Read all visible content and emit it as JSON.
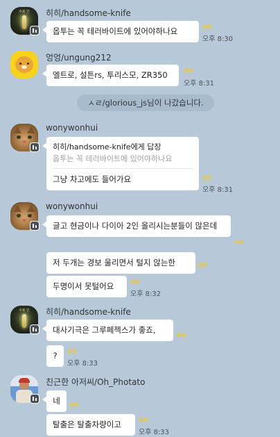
{
  "system": {
    "left_message": "ㅅㄹ/glorious_js님이 나갔습니다."
  },
  "users": {
    "knife": {
      "name": "히히/handsome-knife",
      "avatar_caption": "수호 인"
    },
    "ungung": {
      "name": "엉엉/ungung212"
    },
    "wony": {
      "name": "wonywonhui"
    },
    "photato": {
      "name": "친근한 아저씨/Oh_Photato"
    }
  },
  "messages": [
    {
      "text": "옵투는 꼭 테러바이트에 있어야하나요",
      "unread": "99",
      "time": "오후 8:30"
    },
    {
      "text": "엘트로, 설튼rs, 투리스모, ZR350",
      "unread": "99",
      "time": "오후 8:31"
    },
    {
      "reply_to": "히히/handsome-knife에게 답장",
      "quote": "옵투는 꼭 테러바이트에 있어야하나요",
      "text": "그냥 차고에도 들어가요",
      "unread": "99",
      "time": "오후 8:31"
    },
    {
      "text": "글고 현금이나 다이아 2인 올리시는분들이 많은데",
      "unread": "99"
    },
    {
      "text": "저 두개는 경보 울리면서 털지 않는한",
      "unread": "99"
    },
    {
      "text": "두명이서 못털어요",
      "unread": "99",
      "time": "오후 8:32"
    },
    {
      "text": "대사기극은 그루페젝스가 좋죠,",
      "unread": "99"
    },
    {
      "text": "?",
      "unread": "99",
      "time": "오후 8:33"
    },
    {
      "text": "네",
      "unread": "99"
    },
    {
      "text": "탈출은 탈출차량이고",
      "unread": "99",
      "time": "오후 8:33"
    }
  ]
}
